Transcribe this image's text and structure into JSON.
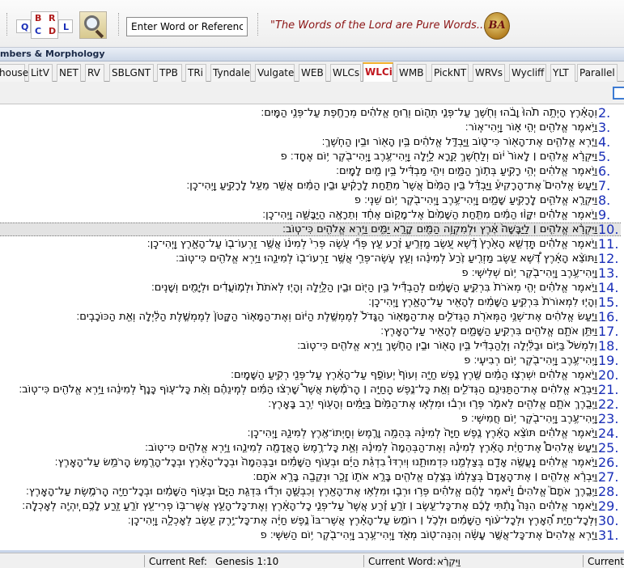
{
  "toolbar": {
    "mode_letters": {
      "q": "Q",
      "b": "B",
      "r": "R",
      "c": "C",
      "d": "D",
      "l": "L"
    },
    "search_placeholder": "Enter Word or Reference",
    "motto": "\"The Words of the Lord are Pure Words...\"",
    "logo_text": "BA"
  },
  "panel_title": "mbers & Morphology",
  "tabs": [
    "house",
    "LitV",
    "NET",
    "RV",
    "SBLGNT",
    "TPB",
    "TRi",
    "Tyndale",
    "Vulgate",
    "WEB",
    "WLCs",
    "WLCi",
    "WMB",
    "PickNT",
    "WRVs",
    "Wycliff",
    "YLT",
    "Parallel"
  ],
  "active_tab": "WLCi",
  "verses": [
    {
      "num": "2.",
      "text": "וְהָאָ֗רֶץ הָיְתָ֥ה תֹ֙הוּ֙ וָבֹ֔הוּ וְחֹ֖שֶׁךְ עַל־פְּנֵ֣י תְה֑וֹם וְר֣וּחַ אֱלֹהִ֔ים מְרַחֶ֖פֶת עַל־פְּנֵ֥י הַמָּֽיִם׃"
    },
    {
      "num": "3.",
      "text": "וַיֹּ֥אמֶר אֱלֹהִ֖ים יְהִ֣י א֑וֹר וַֽיְהִי־אֽוֹר׃"
    },
    {
      "num": "4.",
      "text": "וַיַּ֧רְא אֱלֹהִ֛ים אֶת־הָא֖וֹר כִּי־ט֑וֹב וַיַּבְדֵּ֣ל אֱלֹהִ֔ים בֵּ֥ין הָא֖וֹר וּבֵ֥ין הַחֹֽשֶׁךְ׃"
    },
    {
      "num": "5.",
      "text": "וַיִּקְרָ֨א אֱלֹהִ֤ים ׀ לָאוֹר֙ י֔וֹם וְלַחֹ֖שֶׁךְ קָ֣רָא לָ֑יְלָה וַֽיְהִי־עֶ֥רֶב וַֽיְהִי־בֹ֖קֶר י֥וֹם אֶחָֽד׃ פ"
    },
    {
      "num": "6.",
      "text": "וַיֹּ֣אמֶר אֱלֹהִ֔ים יְהִ֥י רָקִ֖יעַ בְּת֣וֹךְ הַמָּ֑יִם וִיהִ֣י מַבְדִּ֔יל בֵּ֥ין מַ֖יִם לָמָֽיִם׃"
    },
    {
      "num": "7.",
      "text": "וַיַּ֣עַשׂ אֱלֹהִים֮ אֶת־הָרָקִיעַ֒ וַיַּבְדֵּ֗ל בֵּ֤ין הַמַּ֙יִם֙ אֲשֶׁר֙ מִתַּ֣חַת לָרָקִ֔יעַ וּבֵ֣ין הַמַּ֔יִם אֲשֶׁ֖ר מֵעַ֣ל לָרָקִ֑יעַ וַֽיְהִי־כֵֽן׃"
    },
    {
      "num": "8.",
      "text": "וַיִּקְרָ֧א אֱלֹהִ֛ים לָֽרָקִ֖יעַ שָׁמָ֑יִם וַֽיְהִי־עֶ֥רֶב וַֽיְהִי־בֹ֖קֶר י֥וֹם שֵׁנִֽי׃ פ"
    },
    {
      "num": "9.",
      "text": "וַיֹּ֣אמֶר אֱלֹהִ֗ים יִקָּו֨וּ הַמַּ֜יִם מִתַּ֤חַת הַשָּׁמַ֙יִם֙ אֶל־מָק֣וֹם אֶחָ֔ד וְתֵרָאֶ֖ה הַיַּבָּשָׁ֑ה וַֽיְהִי־כֵֽן׃"
    },
    {
      "num": "10.",
      "text": "וַיִּקְרָ֨א אֱלֹהִ֤ים ׀ לַיַּבָּשָׁה֙ אֶ֔רֶץ וּלְמִקְוֵ֥ה הַמַּ֖יִם קָרָ֣א יַמִּ֑ים וַיַּ֥רְא אֱלֹהִ֖ים כִּי־טֽוֹב׃"
    },
    {
      "num": "11.",
      "text": "וַיֹּ֣אמֶר אֱלֹהִ֗ים תַּֽדְשֵׁ֤א הָאָ֙רֶץ֙ דֶּ֔שֶׁא עֵ֚שֶׂב מַזְרִ֣יעַ זֶ֔רַע עֵ֣ץ פְּרִ֞י עֹ֤שֶׂה פְּרִי֙ לְמִינ֔וֹ אֲשֶׁ֥ר זַרְעוֹ־ב֖וֹ עַל־הָאָ֑רֶץ וַֽיְהִי־כֵֽן׃"
    },
    {
      "num": "12.",
      "text": "וַתּוֹצֵ֨א הָאָ֜רֶץ דֶּ֠שֶׁא עֵ֣שֶׂב מַזְרִ֤יעַ זֶ֙רַע֙ לְמִינֵ֔הוּ וְעֵ֧ץ עֹֽשֶׂה־פְּרִ֛י אֲשֶׁ֥ר זַרְעוֹ־ב֖וֹ לְמִינֵ֑הוּ וַיַּ֥רְא אֱלֹהִ֖ים כִּי־טֽוֹב׃"
    },
    {
      "num": "13.",
      "text": "וַֽיְהִי־עֶ֥רֶב וַֽיְהִי־בֹ֖קֶר י֥וֹם שְׁלִישִֽׁי׃ פ"
    },
    {
      "num": "14.",
      "text": "וַיֹּ֣אמֶר אֱלֹהִ֗ים יְהִ֤י מְאֹרֹת֙ בִּרְקִ֣יעַ הַשָּׁמַ֔יִם לְהַבְדִּ֕יל בֵּ֥ין הַיּ֖וֹם וּבֵ֣ין הַלָּ֑יְלָה וְהָי֤וּ לְאֹתֹת֙ וּלְמ֣וֹעֲדִ֔ים וּלְיָמִ֖ים וְשָׁנִֽים׃"
    },
    {
      "num": "15.",
      "text": "וְהָי֤וּ לִמְאוֹרֹת֙ בִּרְקִ֣יעַ הַשָּׁמַ֔יִם לְהָאִ֖יר עַל־הָאָ֑רֶץ וַֽיְהִי־כֵֽן׃"
    },
    {
      "num": "16.",
      "text": "וַיַּ֣עַשׂ אֱלֹהִ֔ים אֶת־שְׁנֵ֥י הַמְּאֹרֹ֖ת הַגְּדֹלִ֑ים אֶת־הַמָּא֤וֹר הַגָּדֹל֙ לְמֶמְשֶׁ֣לֶת הַיּ֔וֹם וְאֶת־הַמָּא֤וֹר הַקָּטֹן֙ לְמֶמְשֶׁ֣לֶת הַלַּ֔יְלָה וְאֵ֖ת הַכּוֹכָבִֽים׃"
    },
    {
      "num": "17.",
      "text": "וַיִּתֵּ֥ן אֹתָ֛ם אֱלֹהִ֖ים בִּרְקִ֣יעַ הַשָּׁמָ֑יִם לְהָאִ֖יר עַל־הָאָֽרֶץ׃"
    },
    {
      "num": "18.",
      "text": "וְלִמְשֹׁל֙ בַּיּ֣וֹם וּבַלַּ֔יְלָה וּֽלֲהַבְדִּ֔יל בֵּ֥ין הָא֖וֹר וּבֵ֣ין הַחֹ֑שֶׁךְ וַיַּ֥רְא אֱלֹהִ֖ים כִּי־טֽוֹב׃"
    },
    {
      "num": "19.",
      "text": "וַֽיְהִי־עֶ֥רֶב וַֽיְהִי־בֹ֖קֶר י֥וֹם רְבִיעִֽי׃ פ"
    },
    {
      "num": "20.",
      "text": "וַיֹּ֣אמֶר אֱלֹהִ֔ים יִשְׁרְצ֣וּ הַמַּ֔יִם שֶׁ֖רֶץ נֶ֣פֶשׁ חַיָּ֑ה וְעוֹף֙ יְעוֹפֵ֣ף עַל־הָאָ֔רֶץ עַל־פְּנֵ֖י רְקִ֥יעַ הַשָּׁמָֽיִם׃"
    },
    {
      "num": "21.",
      "text": "וַיִּבְרָ֣א אֱלֹהִ֔ים אֶת־הַתַּנִּינִ֖ם הַגְּדֹלִ֑ים וְאֵ֣ת כָּל־נֶ֣פֶשׁ הַֽחַיָּ֣ה ׀ הָֽרֹמֶ֡שֶׂת אֲשֶׁר֩ שָׁרְצ֨וּ הַמַּ֜יִם לְמִֽינֵהֶ֗ם וְאֵ֨ת כָּל־ע֤וֹף כָּנָף֙ לְמִינֵ֔הוּ וַיַּ֥רְא אֱלֹהִ֖ים כִּי־טֽוֹב׃"
    },
    {
      "num": "22.",
      "text": "וַיְבָ֧רֶךְ אֹתָ֛ם אֱלֹהִ֖ים לֵאמֹ֑ר פְּר֣וּ וּרְב֗וּ וּמִלְא֤וּ אֶת־הַמַּ֙יִם֙ בַּיַּמִּ֔ים וְהָע֖וֹף יִ֥רֶב בָּאָֽרֶץ׃"
    },
    {
      "num": "23.",
      "text": "וַֽיְהִי־עֶ֥רֶב וַֽיְהִי־בֹ֖קֶר י֥וֹם חֲמִישִֽׁי׃ פ"
    },
    {
      "num": "24.",
      "text": "וַיֹּ֣אמֶר אֱלֹהִ֗ים תּוֹצֵ֨א הָאָ֜רֶץ נֶ֤פֶשׁ חַיָּה֙ לְמִינָ֔הּ בְּהֵמָ֥ה וָרֶ֛מֶשׂ וְחַֽיְתוֹ־אֶ֖רֶץ לְמִינָ֑הּ וַֽיְהִי־כֵֽן׃"
    },
    {
      "num": "25.",
      "text": "וַיַּ֣עַשׂ אֱלֹהִים֩ אֶת־חַיַּ֨ת הָאָ֜רֶץ לְמִינָ֗הּ וְאֶת־הַבְּהֵמָה֙ לְמִינָ֔הּ וְאֵ֛ת כָּל־רֶ֥מֶשׂ הָֽאֲדָמָ֖ה לְמִינֵ֑הוּ וַיַּ֥רְא אֱלֹהִ֖ים כִּי־טֽוֹב׃"
    },
    {
      "num": "26.",
      "text": "וַיֹּ֣אמֶר אֱלֹהִ֔ים נַֽעֲשֶׂ֥ה אָדָ֛ם בְּצַלְמֵ֖נוּ כִּדְמוּתֵ֑נוּ וְיִרְדּוּ֩ בִדְגַ֨ת הַיָּ֜ם וּבְע֣וֹף הַשָּׁמַ֗יִם וּבַבְּהֵמָה֙ וּבְכָל־הָאָ֔רֶץ וּבְכָל־הָרֶ֖מֶשׂ הָֽרֹמֵ֥שׂ עַל־הָאָֽרֶץ׃"
    },
    {
      "num": "27.",
      "text": "וַיִּבְרָ֨א אֱלֹהִ֤ים ׀ אֶת־הָֽאָדָם֙ בְּצַלְמ֔וֹ בְּצֶ֥לֶם אֱלֹהִ֖ים בָּרָ֣א אֹת֑וֹ זָכָ֥ר וּנְקֵבָ֖ה בָּרָ֥א אֹתָֽם׃"
    },
    {
      "num": "28.",
      "text": "וַיְבָ֣רֶךְ אֹתָם֮ אֱלֹהִים֒ וַיֹּ֨אמֶר לָהֶ֜ם אֱלֹהִ֗ים פְּר֥וּ וּרְב֛וּ וּמִלְא֥וּ אֶת־הָאָ֖רֶץ וְכִבְשֻׁ֑הָ וּרְד֞וּ בִּדְגַ֤ת הַיָּם֙ וּבְע֣וֹף הַשָּׁמַ֔יִם וּבְכָל־חַיָּ֖ה הָֽרֹמֶ֥שֶׂת עַל־הָאָֽרֶץ׃"
    },
    {
      "num": "29.",
      "text": "וַיֹּ֣אמֶר אֱלֹהִ֗ים הִנֵּה֩ נָתַ֨תִּי לָכֶ֜ם אֶת־כָּל־עֵ֣שֶׂב ׀ זֹרֵ֣עַ זֶ֗רַע אֲשֶׁר֙ עַל־פְּנֵ֣י כָל־הָאָ֔רֶץ וְאֶת־כָּל־הָעֵ֛ץ אֲשֶׁר־בּ֥וֹ פְרִי־עֵ֖ץ זֹרֵ֣עַ זָ֑רַע לָכֶ֥ם יִֽהְיֶ֖ה לְאָכְלָֽה׃"
    },
    {
      "num": "30.",
      "text": "וּֽלְכָל־חַיַּ֣ת הָ֠אָרֶץ וּלְכָל־ע֨וֹף הַשָּׁמַ֜יִם וּלְכֹ֣ל ׀ רוֹמֵ֣שׂ עַל־הָאָ֗רֶץ אֲשֶׁר־בּוֹ֙ נֶ֣פֶשׁ חַיָּ֔ה אֶת־כָּל־יֶ֥רֶק עֵ֖שֶׂב לְאָכְלָ֑ה וַֽיְהִי־כֵֽן׃"
    },
    {
      "num": "31.",
      "text": "וַיַּ֤רְא אֱלֹהִים֙ אֶת־כָּל־אֲשֶׁ֣ר עָשָׂ֔ה וְהִנֵּה־ט֖וֹב מְאֹ֑ד וַֽיְהִי־עֶ֥רֶב וַֽיְהִי־בֹ֖קֶר י֥וֹם הַשִּׁשִּֽׁי׃ פ"
    }
  ],
  "selected_verse": "10.",
  "status": {
    "ref_label": "Current Ref:",
    "ref_value": "Genesis 1:10",
    "word_label": "Current Word:",
    "word_value": "וַיִּקְרָ֨א",
    "extra_label": "Current"
  }
}
